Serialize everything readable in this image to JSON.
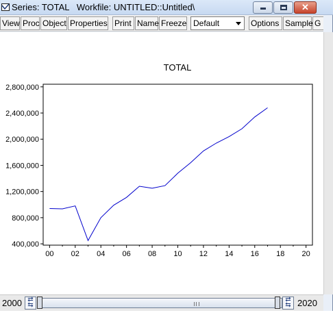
{
  "window": {
    "title": "Series: TOTAL   Workfile: UNTITLED::Untitled\\",
    "close_glyph": "✕"
  },
  "toolbar": {
    "buttons": [
      "View",
      "Proc",
      "Object",
      "Properties",
      "Print",
      "Name",
      "Freeze",
      "Options",
      "Sample",
      "G"
    ],
    "select_value": "Default"
  },
  "sample": {
    "start": "2000",
    "end": "2020"
  },
  "colors": {
    "line": "#0000cc",
    "axis": "#000000"
  },
  "chart_data": {
    "type": "line",
    "title": "TOTAL",
    "xlabel": "",
    "ylabel": "",
    "x_tick_labels": [
      "00",
      "02",
      "04",
      "06",
      "08",
      "10",
      "12",
      "14",
      "16",
      "18",
      "20"
    ],
    "y_tick_labels": [
      "400,000",
      "800,000",
      "1,200,000",
      "1,600,000",
      "2,000,000",
      "2,400,000",
      "2,800,000"
    ],
    "xlim": [
      -0.5,
      20.5
    ],
    "ylim": [
      380000,
      2840000
    ],
    "series": [
      {
        "x": [
          0,
          1,
          2,
          3,
          4,
          5,
          6,
          7,
          8,
          9,
          10,
          11,
          12,
          13,
          14,
          15,
          16,
          17
        ],
        "values": [
          940000,
          935000,
          980000,
          450000,
          800000,
          990000,
          1110000,
          1280000,
          1250000,
          1290000,
          1480000,
          1640000,
          1820000,
          1940000,
          2040000,
          2160000,
          2340000,
          2480000
        ]
      }
    ]
  }
}
